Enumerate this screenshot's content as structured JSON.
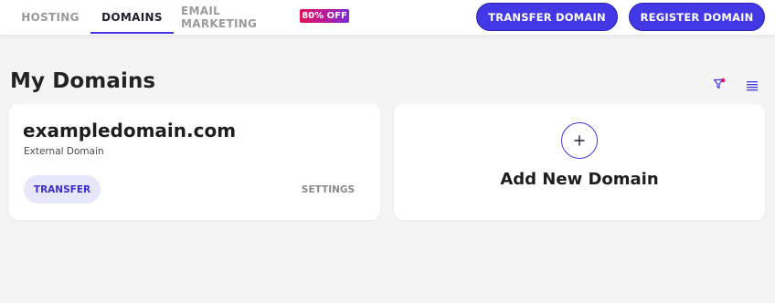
{
  "nav": {
    "tabs": [
      {
        "label": "HOSTING",
        "active": false
      },
      {
        "label": "DOMAINS",
        "active": true
      },
      {
        "label": "EMAIL MARKETING",
        "active": false
      }
    ],
    "promo_badge": "80% OFF",
    "actions": {
      "transfer_label": "TRANSFER DOMAIN",
      "register_label": "REGISTER DOMAIN"
    }
  },
  "main": {
    "title": "My Domains",
    "toolbar_icons": [
      "filter-icon",
      "list-view-icon"
    ],
    "domains": [
      {
        "name": "exampledomain.com",
        "type": "External Domain",
        "primary_action": "TRANSFER",
        "secondary_action": "SETTINGS"
      }
    ],
    "add_card": {
      "label": "Add New Domain",
      "icon": "plus-icon"
    }
  },
  "colors": {
    "accent": "#4338e6",
    "badge_gradient": [
      "#e3115c",
      "#7b2bd6"
    ],
    "background": "#f4f4f4",
    "filter_dot": "#e3115c"
  }
}
